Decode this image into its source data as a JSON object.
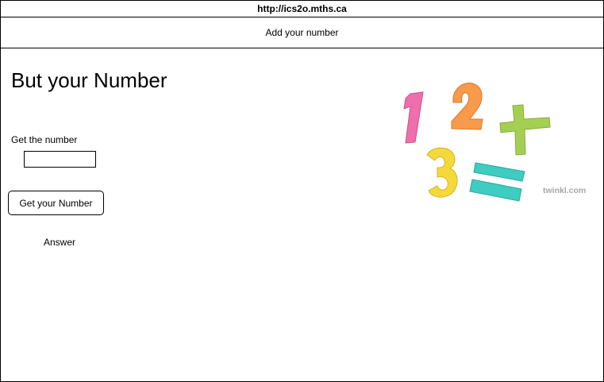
{
  "browser": {
    "url": "http://ics2o.mths.ca"
  },
  "header": {
    "title": "Add your number"
  },
  "main": {
    "heading": "But your Number",
    "input_label": "Get the number",
    "input_value": "",
    "button_label": "Get your Number",
    "answer_text": "Answer"
  },
  "image": {
    "icon": "numbers-math-clipart",
    "watermark": "twinkl.com",
    "colors": {
      "one": "#ef6fae",
      "two": "#f79a4a",
      "three": "#f5d93a",
      "plus": "#a5cf52",
      "equals": "#3ecdc0"
    }
  }
}
